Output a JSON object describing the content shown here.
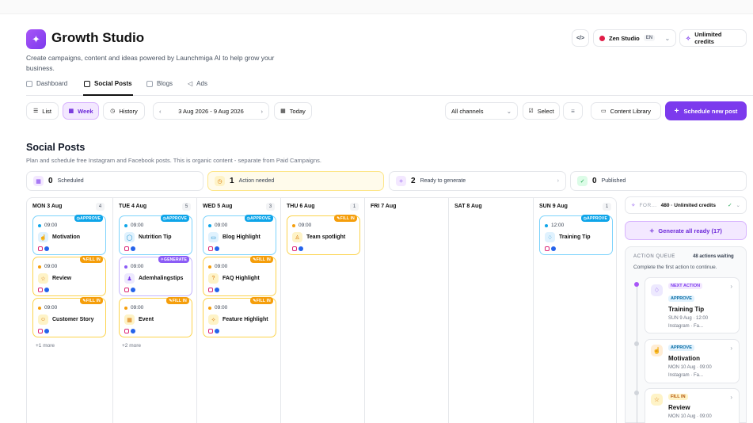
{
  "app": {
    "title": "Growth Studio",
    "subtitle": "Create campaigns, content and ideas powered by Launchmiga AI to help grow your business.",
    "code_label": "</>",
    "workspace": "Zen Studio",
    "lang": "EN",
    "credits_label": "Unlimited credits"
  },
  "nav": [
    {
      "label": "Dashboard"
    },
    {
      "label": "Social Posts"
    },
    {
      "label": "Blogs"
    },
    {
      "label": "Ads"
    }
  ],
  "toolbar": {
    "list": "List",
    "week": "Week",
    "history": "History",
    "range": "3 Aug 2026 - 9 Aug 2026",
    "today": "Today",
    "channels": "All channels",
    "select": "Select",
    "library": "Content Library",
    "schedule": "Schedule new post"
  },
  "section": {
    "title": "Social Posts",
    "subtitle": "Plan and schedule free Instagram and Facebook posts. This is organic content - separate from Paid Campaigns."
  },
  "stats": [
    {
      "num": "0",
      "label": "Scheduled"
    },
    {
      "num": "1",
      "label": "Action needed"
    },
    {
      "num": "2",
      "label": "Ready to generate"
    },
    {
      "num": "0",
      "label": "Published"
    }
  ],
  "days": [
    {
      "label": "MON 3 Aug",
      "count": "4",
      "more": "+1 more",
      "cards": [
        {
          "time": "09:00",
          "name": "Motivation",
          "status": "APPROVE"
        },
        {
          "time": "09:00",
          "name": "Review",
          "status": "FILL IN"
        },
        {
          "time": "09:00",
          "name": "Customer Story",
          "status": "FILL IN"
        }
      ]
    },
    {
      "label": "TUE 4 Aug",
      "count": "5",
      "more": "+2 more",
      "cards": [
        {
          "time": "09:00",
          "name": "Nutrition Tip",
          "status": "APPROVE"
        },
        {
          "time": "09:00",
          "name": "Ademhalingstips",
          "status": "GENERATE"
        },
        {
          "time": "09:00",
          "name": "Event",
          "status": "FILL IN"
        }
      ]
    },
    {
      "label": "WED 5 Aug",
      "count": "3",
      "more": "",
      "cards": [
        {
          "time": "09:00",
          "name": "Blog Highlight",
          "status": "APPROVE"
        },
        {
          "time": "09:00",
          "name": "FAQ Highlight",
          "status": "FILL IN"
        },
        {
          "time": "09:00",
          "name": "Feature Highlight",
          "status": "FILL IN"
        }
      ]
    },
    {
      "label": "THU 6 Aug",
      "count": "1",
      "more": "",
      "cards": [
        {
          "time": "09:00",
          "name": "Team spotlight",
          "status": "FILL IN"
        }
      ]
    },
    {
      "label": "FRI 7 Aug",
      "count": "",
      "more": "",
      "cards": []
    },
    {
      "label": "SAT 8 Aug",
      "count": "",
      "more": "",
      "cards": []
    },
    {
      "label": "SUN 9 Aug",
      "count": "1",
      "more": "",
      "cards": [
        {
          "time": "12:00",
          "name": "Training Tip",
          "status": "APPROVE"
        }
      ]
    }
  ],
  "right": {
    "for_label": "FOR...",
    "credits": "480 · Unlimited credits",
    "generate": "Generate all ready (17)",
    "queue_title": "ACTION QUEUE",
    "queue_count": "48 actions waiting",
    "queue_sub": "Complete the first action to continue.",
    "next_action": "NEXT ACTION",
    "items": [
      {
        "tag": "APPROVE",
        "name": "Training Tip",
        "when": "SUN 9 Aug · 12:00",
        "channel": "Instagram · Fa..."
      },
      {
        "tag": "APPROVE",
        "name": "Motivation",
        "when": "MON 10 Aug · 09:00",
        "channel": "Instagram · Fa..."
      },
      {
        "tag": "FILL IN",
        "name": "Review",
        "when": "MON 10 Aug · 09:00",
        "channel": ""
      }
    ]
  }
}
